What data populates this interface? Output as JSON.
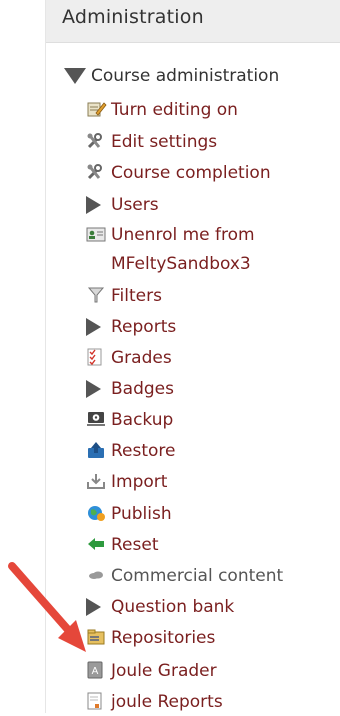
{
  "header": {
    "title": "Administration"
  },
  "tree": {
    "root_label": "Course administration",
    "items": [
      {
        "label": "Turn editing on",
        "icon": "edit-icon"
      },
      {
        "label": "Edit settings",
        "icon": "wrench-icon"
      },
      {
        "label": "Course completion",
        "icon": "wrench-icon"
      },
      {
        "label": "Users",
        "icon": "collapsed-triangle-icon"
      },
      {
        "label": "Unenrol me from",
        "label2": "MFeltySandbox3",
        "icon": "unenrol-user-icon"
      },
      {
        "label": "Filters",
        "icon": "filter-icon"
      },
      {
        "label": "Reports",
        "icon": "collapsed-triangle-icon"
      },
      {
        "label": "Grades",
        "icon": "grades-icon"
      },
      {
        "label": "Badges",
        "icon": "collapsed-triangle-icon"
      },
      {
        "label": "Backup",
        "icon": "backup-icon"
      },
      {
        "label": "Restore",
        "icon": "restore-icon"
      },
      {
        "label": "Import",
        "icon": "import-icon"
      },
      {
        "label": "Publish",
        "icon": "publish-globe-icon"
      },
      {
        "label": "Reset",
        "icon": "reset-arrow-icon"
      },
      {
        "label": "Commercial content",
        "icon": "cloud-icon"
      },
      {
        "label": "Question bank",
        "icon": "collapsed-triangle-icon"
      },
      {
        "label": "Repositories",
        "icon": "repository-icon"
      },
      {
        "label": "Joule Grader",
        "icon": "joule-grader-icon"
      },
      {
        "label": "joule Reports",
        "icon": "joule-reports-icon"
      }
    ]
  },
  "colors": {
    "link": "#7a1f1f",
    "annotation_arrow": "#e5473a",
    "header_bg": "#eeeeee"
  }
}
